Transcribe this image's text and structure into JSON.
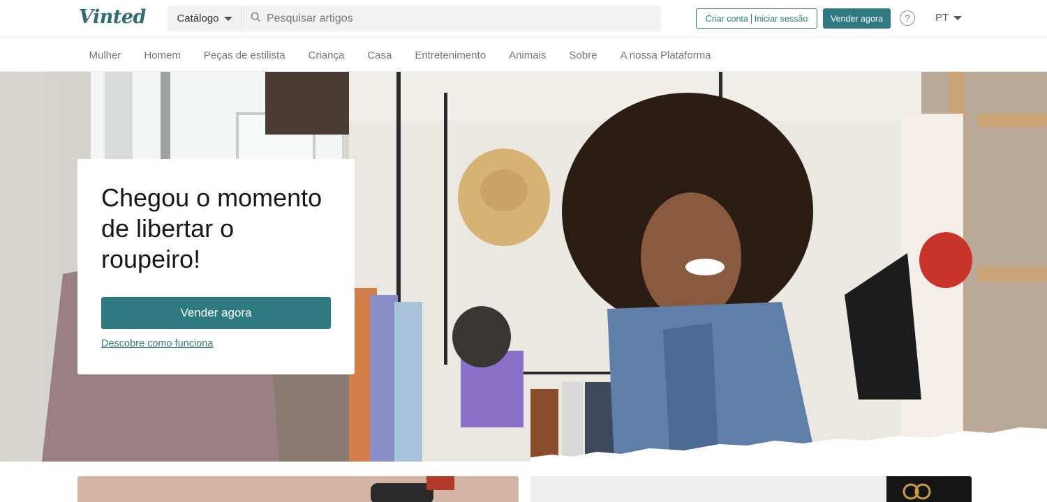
{
  "header": {
    "logo": "Vinted",
    "catalog_label": "Catálogo",
    "search_placeholder": "Pesquisar artigos",
    "signup_label": "Criar conta",
    "login_label": "Iniciar sessão",
    "sell_label": "Vender agora",
    "help_icon": "question-circle-icon",
    "language": "PT"
  },
  "nav": {
    "items": [
      "Mulher",
      "Homem",
      "Peças de estilista",
      "Criança",
      "Casa",
      "Entretenimento",
      "Animais",
      "Sobre",
      "A nossa Plataforma"
    ]
  },
  "hero": {
    "title": "Chegou o momento de libertar o roupeiro!",
    "cta_label": "Vender agora",
    "link_label": "Descobre como funciona"
  },
  "colors": {
    "brand": "#2f7a80",
    "logo": "#2f6d73"
  }
}
